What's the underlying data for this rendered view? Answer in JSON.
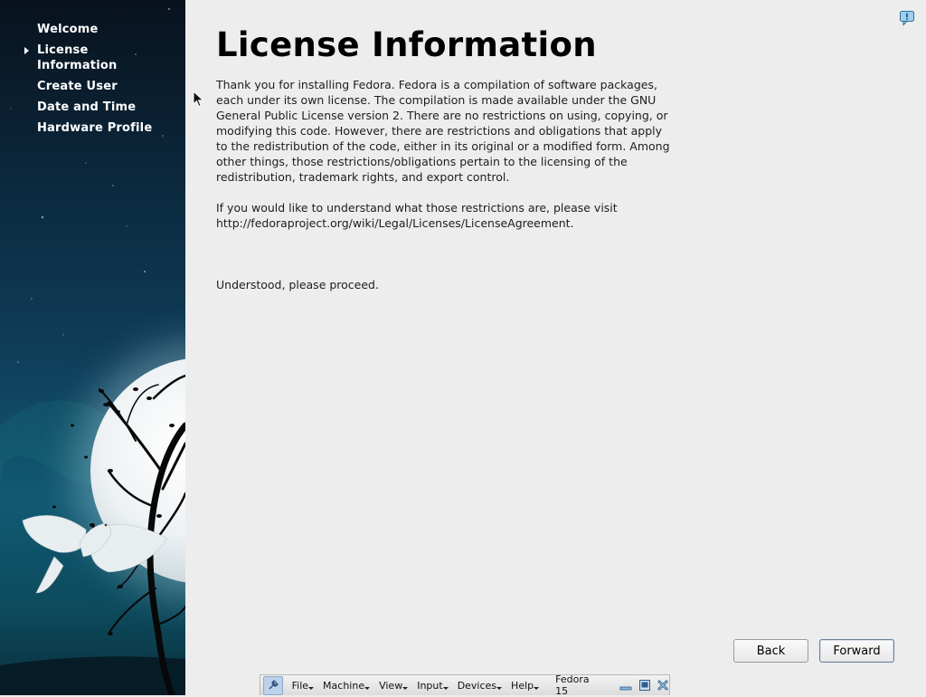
{
  "sidebar": {
    "items": [
      {
        "label": "Welcome",
        "active": false
      },
      {
        "label": "License Information",
        "active": true
      },
      {
        "label": "Create User",
        "active": false
      },
      {
        "label": "Date and Time",
        "active": false
      },
      {
        "label": "Hardware Profile",
        "active": false
      }
    ]
  },
  "main": {
    "title": "License Information",
    "paragraphs": [
      "Thank you for installing Fedora.  Fedora is a compilation of software packages, each under its own license.  The compilation is made available under the GNU General Public License version 2.  There are no restrictions on using, copying, or modifying this code.  However, there are restrictions and obligations that apply to the redistribution of the code, either in its original or a modified form.  Among other things, those restrictions/obligations pertain to the licensing of the redistribution, trademark rights, and export control.",
      "If you would like to understand what those restrictions are, please visit http://fedoraproject.org/wiki/Legal/Licenses/LicenseAgreement.",
      "Understood, please proceed."
    ],
    "back_label": "Back",
    "forward_label": "Forward"
  },
  "vbox_toolbar": {
    "menus": [
      "File",
      "Machine",
      "View",
      "Input",
      "Devices",
      "Help"
    ],
    "vm_name": "Fedora 15"
  },
  "icons": {
    "help": "help-icon",
    "pin": "pin-icon",
    "minimize": "minimize-icon",
    "restore": "restore-icon",
    "close": "close-icon"
  },
  "colors": {
    "sidebar_top": "#08121d",
    "sidebar_bottom": "#115a73",
    "content_bg": "#ededed",
    "forward_border": "#6b7f99"
  }
}
